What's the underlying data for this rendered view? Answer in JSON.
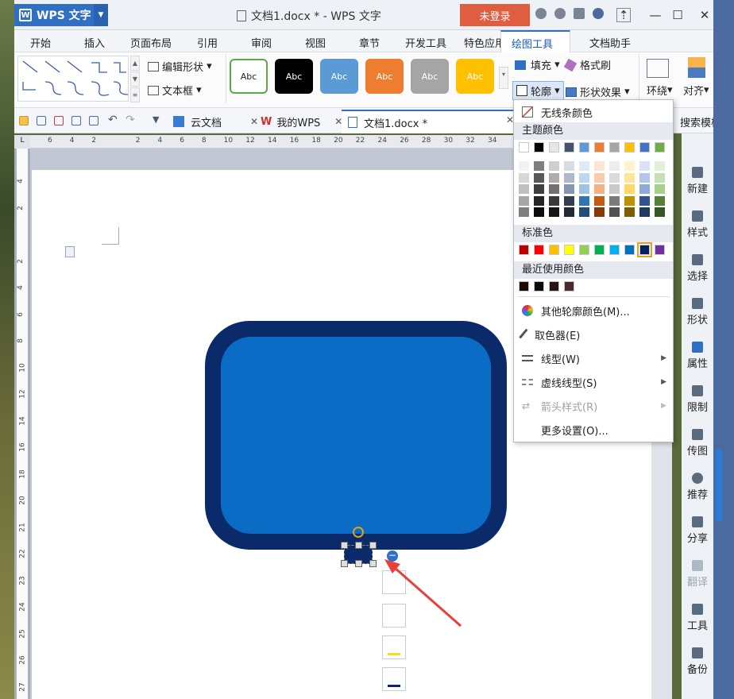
{
  "app": {
    "brand": "WPS 文字",
    "title": "文档1.docx * - WPS 文字",
    "login": "未登录"
  },
  "menu": {
    "tabs": [
      "开始",
      "插入",
      "页面布局",
      "引用",
      "审阅",
      "视图",
      "章节",
      "开发工具",
      "特色应用",
      "绘图工具",
      "文档助手"
    ],
    "active": "绘图工具"
  },
  "ribbon": {
    "edit_shape": "编辑形状",
    "textbox": "文本框",
    "style_label": "Abc",
    "style_colors": [
      "#ffffff",
      "#000000",
      "#5b9bd5",
      "#ed7d31",
      "#a5a5a5",
      "#ffc000"
    ],
    "fill": "填充",
    "format_painter": "格式刷",
    "outline": "轮廓",
    "shape_effect": "形状效果",
    "wrap": "环绕",
    "align": "对齐"
  },
  "doc_tabs": {
    "cloud": "云文档",
    "my_wps": "我的WPS",
    "doc": "文档1.docx *",
    "search_template": "搜索模板"
  },
  "ruler": {
    "h_labels": [
      "6",
      "4",
      "2",
      "",
      "2",
      "4",
      "6",
      "8",
      "10",
      "12",
      "14",
      "16",
      "18",
      "20",
      "22",
      "24",
      "26",
      "28",
      "30",
      "32",
      "34"
    ],
    "v_labels": [
      "4",
      "2",
      "",
      "2",
      "4",
      "6",
      "8",
      "10",
      "12",
      "14",
      "16",
      "18",
      "20",
      "21",
      "22",
      "23",
      "24",
      "25",
      "26",
      "27"
    ],
    "corner": "L"
  },
  "sidebar": {
    "items": [
      "新建",
      "样式",
      "选择",
      "形状",
      "属性",
      "限制",
      "传图",
      "推荐",
      "分享",
      "翻译",
      "工具",
      "备份"
    ]
  },
  "dropdown": {
    "no_outline": "无线条颜色",
    "theme_colors": "主题颜色",
    "theme_top": [
      "#ffffff",
      "#000000",
      "#e7e6e6",
      "#44546a",
      "#5b9bd5",
      "#ed7d31",
      "#a5a5a5",
      "#ffc000",
      "#4472c4",
      "#70ad47"
    ],
    "theme_grid": [
      [
        "#f2f2f2",
        "#7f7f7f",
        "#d0cece",
        "#d6dce4",
        "#deebf6",
        "#fbe5d5",
        "#ededed",
        "#fff2cc",
        "#dae3f3",
        "#e2efd9"
      ],
      [
        "#d8d8d8",
        "#595959",
        "#aeabab",
        "#adb9ca",
        "#bdd7ee",
        "#f7cbac",
        "#dbdbdb",
        "#ffe599",
        "#b4c6e7",
        "#c5e0b3"
      ],
      [
        "#bfbfbf",
        "#3f3f3f",
        "#757070",
        "#8496b0",
        "#9dc3e6",
        "#f4b183",
        "#c9c9c9",
        "#ffd965",
        "#8eaadb",
        "#a8d08d"
      ],
      [
        "#a5a5a5",
        "#262626",
        "#3a3838",
        "#323f4f",
        "#2e75b5",
        "#c55a11",
        "#7b7b7b",
        "#bf9000",
        "#2f5496",
        "#538135"
      ],
      [
        "#7f7f7f",
        "#0c0c0c",
        "#171616",
        "#222a35",
        "#1e4e79",
        "#843c0b",
        "#525252",
        "#7f6000",
        "#1f3864",
        "#375623"
      ]
    ],
    "standard_colors": "标准色",
    "standard": [
      "#c00000",
      "#ff0000",
      "#ffc000",
      "#ffff00",
      "#92d050",
      "#00b050",
      "#00b0f0",
      "#0070c0",
      "#002060",
      "#7030a0"
    ],
    "recent_colors": "最近使用颜色",
    "recent": [
      "#1a0a00",
      "#0a0a0a",
      "#2a1410",
      "#4a2a2a"
    ],
    "more_colors": "其他轮廓颜色(M)...",
    "eyedropper": "取色器(E)",
    "line_type": "线型(W)",
    "dash_type": "虚线线型(S)",
    "arrow_style": "箭头样式(R)",
    "more_settings": "更多设置(O)..."
  }
}
